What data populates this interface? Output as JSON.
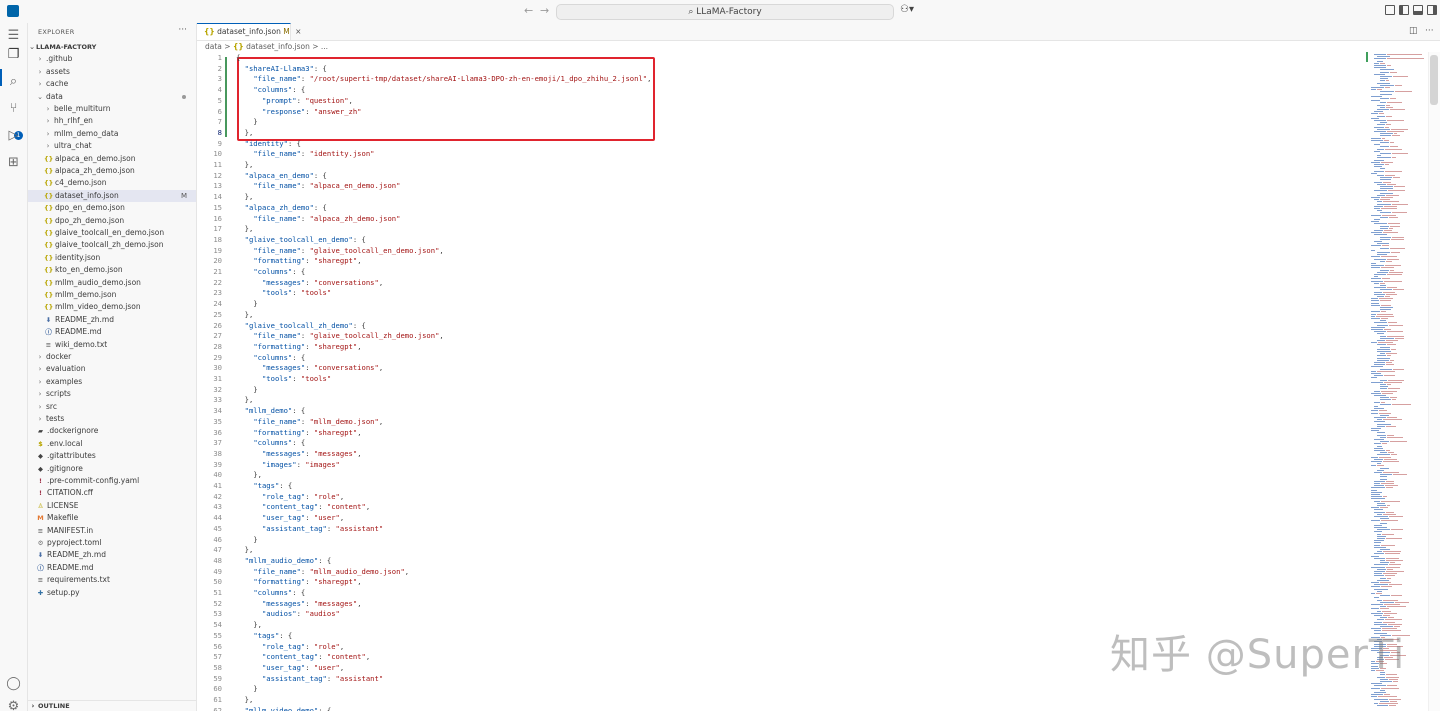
{
  "titlebar": {
    "search_text": "LLaMA-Factory",
    "back": "←",
    "forward": "→",
    "copilot": "⚇▾"
  },
  "sidebar": {
    "header": "EXPLORER",
    "more": "···",
    "root": "LLAMA-FACTORY",
    "outline": "OUTLINE",
    "items": [
      {
        "label": ".github",
        "kind": "folder",
        "indent": 1,
        "open": false
      },
      {
        "label": "assets",
        "kind": "folder",
        "indent": 1,
        "open": false
      },
      {
        "label": "cache",
        "kind": "folder",
        "indent": 1,
        "open": false
      },
      {
        "label": "data",
        "kind": "folder",
        "indent": 1,
        "open": true,
        "dot": true
      },
      {
        "label": "belle_multiturn",
        "kind": "folder",
        "indent": 2,
        "open": false
      },
      {
        "label": "hh_rlhf_en",
        "kind": "folder",
        "indent": 2,
        "open": false
      },
      {
        "label": "mllm_demo_data",
        "kind": "folder",
        "indent": 2,
        "open": false
      },
      {
        "label": "ultra_chat",
        "kind": "folder",
        "indent": 2,
        "open": false
      },
      {
        "label": "alpaca_en_demo.json",
        "kind": "json",
        "indent": 2
      },
      {
        "label": "alpaca_zh_demo.json",
        "kind": "json",
        "indent": 2
      },
      {
        "label": "c4_demo.json",
        "kind": "json",
        "indent": 2
      },
      {
        "label": "dataset_info.json",
        "kind": "json",
        "indent": 2,
        "selected": true,
        "git": "M"
      },
      {
        "label": "dpo_en_demo.json",
        "kind": "json",
        "indent": 2
      },
      {
        "label": "dpo_zh_demo.json",
        "kind": "json",
        "indent": 2
      },
      {
        "label": "glaive_toolcall_en_demo.json",
        "kind": "json",
        "indent": 2
      },
      {
        "label": "glaive_toolcall_zh_demo.json",
        "kind": "json",
        "indent": 2
      },
      {
        "label": "identity.json",
        "kind": "json",
        "indent": 2
      },
      {
        "label": "kto_en_demo.json",
        "kind": "json",
        "indent": 2
      },
      {
        "label": "mllm_audio_demo.json",
        "kind": "json",
        "indent": 2
      },
      {
        "label": "mllm_demo.json",
        "kind": "json",
        "indent": 2
      },
      {
        "label": "mllm_video_demo.json",
        "kind": "json",
        "indent": 2
      },
      {
        "label": "README_zh.md",
        "kind": "md-down",
        "indent": 2
      },
      {
        "label": "README.md",
        "kind": "info",
        "indent": 2
      },
      {
        "label": "wiki_demo.txt",
        "kind": "txt",
        "indent": 2
      },
      {
        "label": "docker",
        "kind": "folder",
        "indent": 1,
        "open": false
      },
      {
        "label": "evaluation",
        "kind": "folder",
        "indent": 1,
        "open": false
      },
      {
        "label": "examples",
        "kind": "folder",
        "indent": 1,
        "open": false
      },
      {
        "label": "scripts",
        "kind": "folder",
        "indent": 1,
        "open": false
      },
      {
        "label": "src",
        "kind": "folder",
        "indent": 1,
        "open": false
      },
      {
        "label": "tests",
        "kind": "folder",
        "indent": 1,
        "open": false
      },
      {
        "label": ".dockerignore",
        "kind": "docker",
        "indent": 1
      },
      {
        "label": ".env.local",
        "kind": "env",
        "indent": 1
      },
      {
        "label": ".gitattributes",
        "kind": "git",
        "indent": 1
      },
      {
        "label": ".gitignore",
        "kind": "git",
        "indent": 1
      },
      {
        "label": ".pre-commit-config.yaml",
        "kind": "yaml",
        "indent": 1
      },
      {
        "label": "CITATION.cff",
        "kind": "cff",
        "indent": 1
      },
      {
        "label": "LICENSE",
        "kind": "license",
        "indent": 1
      },
      {
        "label": "Makefile",
        "kind": "make",
        "indent": 1
      },
      {
        "label": "MANIFEST.in",
        "kind": "txt",
        "indent": 1
      },
      {
        "label": "pyproject.toml",
        "kind": "toml",
        "indent": 1
      },
      {
        "label": "README_zh.md",
        "kind": "md-down",
        "indent": 1
      },
      {
        "label": "README.md",
        "kind": "info",
        "indent": 1
      },
      {
        "label": "requirements.txt",
        "kind": "txt",
        "indent": 1
      },
      {
        "label": "setup.py",
        "kind": "py",
        "indent": 1
      }
    ]
  },
  "tab": {
    "icon": "{}",
    "label": "dataset_info.json",
    "modified": "M",
    "close": "×"
  },
  "breadcrumb": {
    "folder": "data",
    "sep": ">",
    "icon": "{}",
    "file": "dataset_info.json",
    "more": "..."
  },
  "editor": {
    "active_line": 8,
    "lines": [
      [
        [
          "p",
          "{"
        ]
      ],
      [
        [
          "p",
          "  "
        ],
        [
          "k",
          "\"shareAI-Llama3\""
        ],
        [
          "p",
          ": {"
        ]
      ],
      [
        [
          "p",
          "    "
        ],
        [
          "k",
          "\"file_name\""
        ],
        [
          "p",
          ": "
        ],
        [
          "s",
          "\"/root/superti-tmp/dataset/shareAI-Llama3-DPO-zh-en-emoji/1_dpo_zhihu_2.jsonl\""
        ],
        [
          "p",
          ","
        ]
      ],
      [
        [
          "p",
          "    "
        ],
        [
          "k",
          "\"columns\""
        ],
        [
          "p",
          ": {"
        ]
      ],
      [
        [
          "p",
          "      "
        ],
        [
          "k",
          "\"prompt\""
        ],
        [
          "p",
          ": "
        ],
        [
          "s",
          "\"question\""
        ],
        [
          "p",
          ","
        ]
      ],
      [
        [
          "p",
          "      "
        ],
        [
          "k",
          "\"response\""
        ],
        [
          "p",
          ": "
        ],
        [
          "s",
          "\"answer_zh\""
        ]
      ],
      [
        [
          "p",
          "    }"
        ]
      ],
      [
        [
          "p",
          "  },"
        ]
      ],
      [
        [
          "p",
          "  "
        ],
        [
          "k",
          "\"identity\""
        ],
        [
          "p",
          ": {"
        ]
      ],
      [
        [
          "p",
          "    "
        ],
        [
          "k",
          "\"file_name\""
        ],
        [
          "p",
          ": "
        ],
        [
          "s",
          "\"identity.json\""
        ]
      ],
      [
        [
          "p",
          "  },"
        ]
      ],
      [
        [
          "p",
          "  "
        ],
        [
          "k",
          "\"alpaca_en_demo\""
        ],
        [
          "p",
          ": {"
        ]
      ],
      [
        [
          "p",
          "    "
        ],
        [
          "k",
          "\"file_name\""
        ],
        [
          "p",
          ": "
        ],
        [
          "s",
          "\"alpaca_en_demo.json\""
        ]
      ],
      [
        [
          "p",
          "  },"
        ]
      ],
      [
        [
          "p",
          "  "
        ],
        [
          "k",
          "\"alpaca_zh_demo\""
        ],
        [
          "p",
          ": {"
        ]
      ],
      [
        [
          "p",
          "    "
        ],
        [
          "k",
          "\"file_name\""
        ],
        [
          "p",
          ": "
        ],
        [
          "s",
          "\"alpaca_zh_demo.json\""
        ]
      ],
      [
        [
          "p",
          "  },"
        ]
      ],
      [
        [
          "p",
          "  "
        ],
        [
          "k",
          "\"glaive_toolcall_en_demo\""
        ],
        [
          "p",
          ": {"
        ]
      ],
      [
        [
          "p",
          "    "
        ],
        [
          "k",
          "\"file_name\""
        ],
        [
          "p",
          ": "
        ],
        [
          "s",
          "\"glaive_toolcall_en_demo.json\""
        ],
        [
          "p",
          ","
        ]
      ],
      [
        [
          "p",
          "    "
        ],
        [
          "k",
          "\"formatting\""
        ],
        [
          "p",
          ": "
        ],
        [
          "s",
          "\"sharegpt\""
        ],
        [
          "p",
          ","
        ]
      ],
      [
        [
          "p",
          "    "
        ],
        [
          "k",
          "\"columns\""
        ],
        [
          "p",
          ": {"
        ]
      ],
      [
        [
          "p",
          "      "
        ],
        [
          "k",
          "\"messages\""
        ],
        [
          "p",
          ": "
        ],
        [
          "s",
          "\"conversations\""
        ],
        [
          "p",
          ","
        ]
      ],
      [
        [
          "p",
          "      "
        ],
        [
          "k",
          "\"tools\""
        ],
        [
          "p",
          ": "
        ],
        [
          "s",
          "\"tools\""
        ]
      ],
      [
        [
          "p",
          "    }"
        ]
      ],
      [
        [
          "p",
          "  },"
        ]
      ],
      [
        [
          "p",
          "  "
        ],
        [
          "k",
          "\"glaive_toolcall_zh_demo\""
        ],
        [
          "p",
          ": {"
        ]
      ],
      [
        [
          "p",
          "    "
        ],
        [
          "k",
          "\"file_name\""
        ],
        [
          "p",
          ": "
        ],
        [
          "s",
          "\"glaive_toolcall_zh_demo.json\""
        ],
        [
          "p",
          ","
        ]
      ],
      [
        [
          "p",
          "    "
        ],
        [
          "k",
          "\"formatting\""
        ],
        [
          "p",
          ": "
        ],
        [
          "s",
          "\"sharegpt\""
        ],
        [
          "p",
          ","
        ]
      ],
      [
        [
          "p",
          "    "
        ],
        [
          "k",
          "\"columns\""
        ],
        [
          "p",
          ": {"
        ]
      ],
      [
        [
          "p",
          "      "
        ],
        [
          "k",
          "\"messages\""
        ],
        [
          "p",
          ": "
        ],
        [
          "s",
          "\"conversations\""
        ],
        [
          "p",
          ","
        ]
      ],
      [
        [
          "p",
          "      "
        ],
        [
          "k",
          "\"tools\""
        ],
        [
          "p",
          ": "
        ],
        [
          "s",
          "\"tools\""
        ]
      ],
      [
        [
          "p",
          "    }"
        ]
      ],
      [
        [
          "p",
          "  },"
        ]
      ],
      [
        [
          "p",
          "  "
        ],
        [
          "k",
          "\"mllm_demo\""
        ],
        [
          "p",
          ": {"
        ]
      ],
      [
        [
          "p",
          "    "
        ],
        [
          "k",
          "\"file_name\""
        ],
        [
          "p",
          ": "
        ],
        [
          "s",
          "\"mllm_demo.json\""
        ],
        [
          "p",
          ","
        ]
      ],
      [
        [
          "p",
          "    "
        ],
        [
          "k",
          "\"formatting\""
        ],
        [
          "p",
          ": "
        ],
        [
          "s",
          "\"sharegpt\""
        ],
        [
          "p",
          ","
        ]
      ],
      [
        [
          "p",
          "    "
        ],
        [
          "k",
          "\"columns\""
        ],
        [
          "p",
          ": {"
        ]
      ],
      [
        [
          "p",
          "      "
        ],
        [
          "k",
          "\"messages\""
        ],
        [
          "p",
          ": "
        ],
        [
          "s",
          "\"messages\""
        ],
        [
          "p",
          ","
        ]
      ],
      [
        [
          "p",
          "      "
        ],
        [
          "k",
          "\"images\""
        ],
        [
          "p",
          ": "
        ],
        [
          "s",
          "\"images\""
        ]
      ],
      [
        [
          "p",
          "    },"
        ]
      ],
      [
        [
          "p",
          "    "
        ],
        [
          "k",
          "\"tags\""
        ],
        [
          "p",
          ": {"
        ]
      ],
      [
        [
          "p",
          "      "
        ],
        [
          "k",
          "\"role_tag\""
        ],
        [
          "p",
          ": "
        ],
        [
          "s",
          "\"role\""
        ],
        [
          "p",
          ","
        ]
      ],
      [
        [
          "p",
          "      "
        ],
        [
          "k",
          "\"content_tag\""
        ],
        [
          "p",
          ": "
        ],
        [
          "s",
          "\"content\""
        ],
        [
          "p",
          ","
        ]
      ],
      [
        [
          "p",
          "      "
        ],
        [
          "k",
          "\"user_tag\""
        ],
        [
          "p",
          ": "
        ],
        [
          "s",
          "\"user\""
        ],
        [
          "p",
          ","
        ]
      ],
      [
        [
          "p",
          "      "
        ],
        [
          "k",
          "\"assistant_tag\""
        ],
        [
          "p",
          ": "
        ],
        [
          "s",
          "\"assistant\""
        ]
      ],
      [
        [
          "p",
          "    }"
        ]
      ],
      [
        [
          "p",
          "  },"
        ]
      ],
      [
        [
          "p",
          "  "
        ],
        [
          "k",
          "\"mllm_audio_demo\""
        ],
        [
          "p",
          ": {"
        ]
      ],
      [
        [
          "p",
          "    "
        ],
        [
          "k",
          "\"file_name\""
        ],
        [
          "p",
          ": "
        ],
        [
          "s",
          "\"mllm_audio_demo.json\""
        ],
        [
          "p",
          ","
        ]
      ],
      [
        [
          "p",
          "    "
        ],
        [
          "k",
          "\"formatting\""
        ],
        [
          "p",
          ": "
        ],
        [
          "s",
          "\"sharegpt\""
        ],
        [
          "p",
          ","
        ]
      ],
      [
        [
          "p",
          "    "
        ],
        [
          "k",
          "\"columns\""
        ],
        [
          "p",
          ": {"
        ]
      ],
      [
        [
          "p",
          "      "
        ],
        [
          "k",
          "\"messages\""
        ],
        [
          "p",
          ": "
        ],
        [
          "s",
          "\"messages\""
        ],
        [
          "p",
          ","
        ]
      ],
      [
        [
          "p",
          "      "
        ],
        [
          "k",
          "\"audios\""
        ],
        [
          "p",
          ": "
        ],
        [
          "s",
          "\"audios\""
        ]
      ],
      [
        [
          "p",
          "    },"
        ]
      ],
      [
        [
          "p",
          "    "
        ],
        [
          "k",
          "\"tags\""
        ],
        [
          "p",
          ": {"
        ]
      ],
      [
        [
          "p",
          "      "
        ],
        [
          "k",
          "\"role_tag\""
        ],
        [
          "p",
          ": "
        ],
        [
          "s",
          "\"role\""
        ],
        [
          "p",
          ","
        ]
      ],
      [
        [
          "p",
          "      "
        ],
        [
          "k",
          "\"content_tag\""
        ],
        [
          "p",
          ": "
        ],
        [
          "s",
          "\"content\""
        ],
        [
          "p",
          ","
        ]
      ],
      [
        [
          "p",
          "      "
        ],
        [
          "k",
          "\"user_tag\""
        ],
        [
          "p",
          ": "
        ],
        [
          "s",
          "\"user\""
        ],
        [
          "p",
          ","
        ]
      ],
      [
        [
          "p",
          "      "
        ],
        [
          "k",
          "\"assistant_tag\""
        ],
        [
          "p",
          ": "
        ],
        [
          "s",
          "\"assistant\""
        ]
      ],
      [
        [
          "p",
          "    }"
        ]
      ],
      [
        [
          "p",
          "  },"
        ]
      ],
      [
        [
          "p",
          "  "
        ],
        [
          "k",
          "\"mllm_video_demo\""
        ],
        [
          "p",
          ": {"
        ]
      ]
    ]
  },
  "watermark": "知乎 @SuperTi",
  "colors": {
    "accent": "#005fb8",
    "highlight_box": "#e0242e",
    "json_key": "#0451a5",
    "json_string": "#a31515",
    "git_modified": "#48985d"
  }
}
